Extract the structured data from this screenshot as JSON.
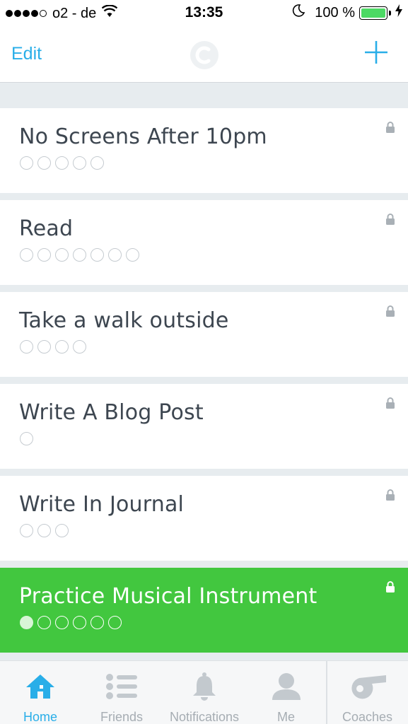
{
  "status_bar": {
    "carrier": "o2 - de",
    "time": "13:35",
    "battery_percent": "100 %",
    "signal_bars_filled": 4,
    "battery_level": 1.0,
    "icons": [
      "wifi-icon",
      "moon-icon",
      "battery-icon",
      "charging-bolt-icon"
    ]
  },
  "nav": {
    "edit_label": "Edit",
    "logo_icon": "coach-logo-icon",
    "add_icon": "plus-icon"
  },
  "colors": {
    "accent": "#29aee8",
    "active_green": "#42c73f",
    "text": "#3d4650",
    "background": "#e7ecef"
  },
  "habits": [
    {
      "title": "No Screens After 10pm",
      "circles": 5,
      "filled": 0,
      "active": false
    },
    {
      "title": "Read",
      "circles": 7,
      "filled": 0,
      "active": false
    },
    {
      "title": "Take a walk outside",
      "circles": 4,
      "filled": 0,
      "active": false
    },
    {
      "title": "Write A Blog Post",
      "circles": 1,
      "filled": 0,
      "active": false
    },
    {
      "title": "Write In Journal",
      "circles": 3,
      "filled": 0,
      "active": false
    },
    {
      "title": "Practice Musical Instrument",
      "circles": 6,
      "filled": 1,
      "active": true
    }
  ],
  "tabs": [
    {
      "label": "Home",
      "icon": "home-icon",
      "active": true
    },
    {
      "label": "Friends",
      "icon": "list-icon",
      "active": false
    },
    {
      "label": "Notifications",
      "icon": "bell-icon",
      "active": false
    },
    {
      "label": "Me",
      "icon": "person-icon",
      "active": false
    },
    {
      "label": "Coaches",
      "icon": "whistle-icon",
      "active": false
    }
  ]
}
